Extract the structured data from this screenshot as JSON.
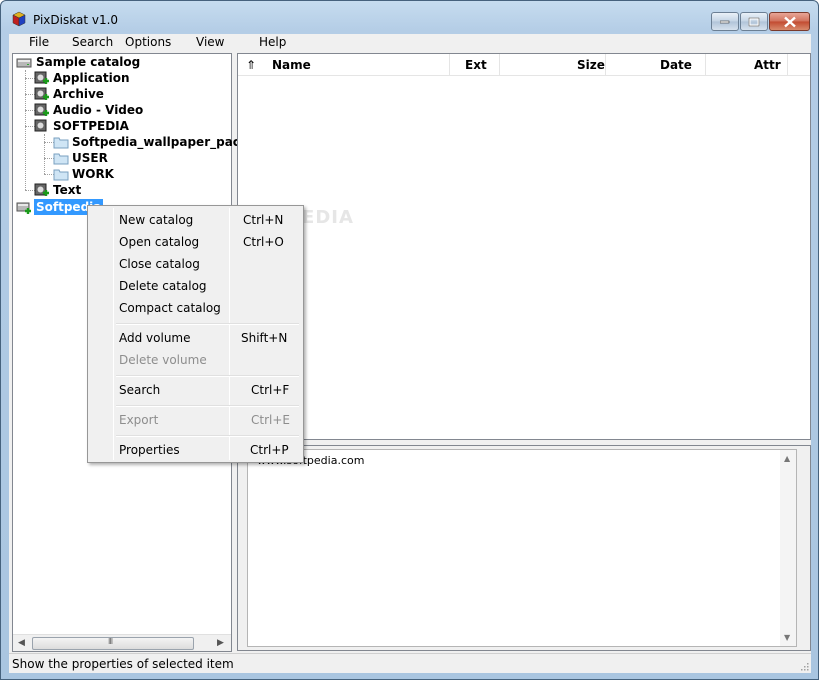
{
  "window": {
    "title": "PixDiskat v1.0"
  },
  "menubar": {
    "items": [
      "File",
      "Search",
      "Options",
      "View",
      "Help"
    ]
  },
  "tree": {
    "root": "Sample catalog",
    "children": [
      "Application",
      "Archive",
      "Audio - Video",
      "SOFTPEDIA",
      "Text"
    ],
    "softpedia_children": [
      "Softpedia_wallpaper_pack",
      "USER",
      "WORK"
    ],
    "selected_catalog": "Softpedia",
    "scroll_grip": "III"
  },
  "list": {
    "sort_icon": "⇑",
    "columns": [
      "Name",
      "Ext",
      "Size",
      "Date",
      "Attr"
    ]
  },
  "info": {
    "text": "www.softpedia.com"
  },
  "status": {
    "text": "Show the properties of selected item"
  },
  "context_menu": {
    "items": [
      {
        "label": "New catalog",
        "shortcut": "Ctrl+N",
        "enabled": true
      },
      {
        "label": "Open catalog",
        "shortcut": "Ctrl+O",
        "enabled": true
      },
      {
        "label": "Close catalog",
        "shortcut": "",
        "enabled": true
      },
      {
        "label": "Delete catalog",
        "shortcut": "",
        "enabled": true
      },
      {
        "label": "Compact catalog",
        "shortcut": "",
        "enabled": true
      },
      {
        "label": "Add volume",
        "shortcut": "Shift+N",
        "enabled": true
      },
      {
        "label": "Delete volume",
        "shortcut": "",
        "enabled": false
      },
      {
        "label": "Search",
        "shortcut": "Ctrl+F",
        "enabled": true
      },
      {
        "label": "Export",
        "shortcut": "Ctrl+E",
        "enabled": false
      },
      {
        "label": "Properties",
        "shortcut": "Ctrl+P",
        "enabled": true
      }
    ]
  },
  "watermark": "SOFTPEDIA",
  "colors": {
    "selection": "#3399ff",
    "disabled_text": "#8d8d8d"
  }
}
